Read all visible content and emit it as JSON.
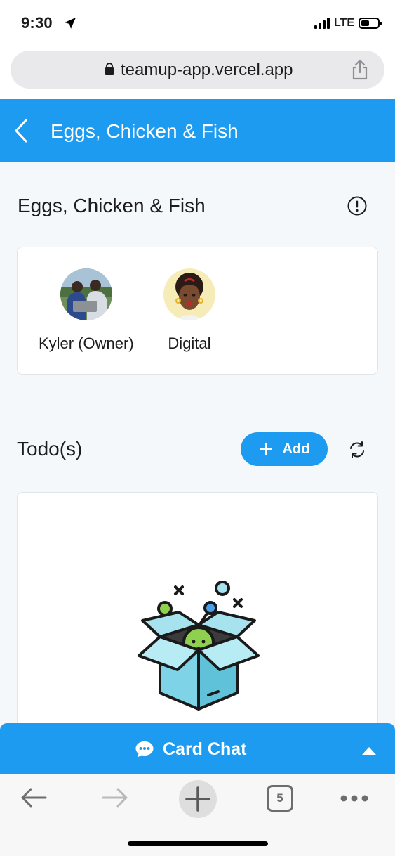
{
  "status_bar": {
    "time": "9:30",
    "network": "LTE",
    "icons": [
      "location-arrow-icon",
      "signal-icon",
      "battery-icon"
    ]
  },
  "browser": {
    "url": "teamup-app.vercel.app",
    "toolbar": {
      "tabs_count": "5",
      "icons": [
        "back-arrow-icon",
        "forward-arrow-icon",
        "new-tab-plus-icon",
        "tabs-icon",
        "more-icon"
      ]
    }
  },
  "header": {
    "title": "Eggs, Chicken & Fish",
    "back_icon": "chevron-left-icon"
  },
  "group": {
    "title": "Eggs, Chicken & Fish",
    "info_icon": "info-circle-icon"
  },
  "members": [
    {
      "name": "Kyler (Owner)"
    },
    {
      "name": "Digital"
    }
  ],
  "todos": {
    "title": "Todo(s)",
    "add_label": "Add",
    "refresh_icon": "refresh-icon",
    "empty_illustration": "empty-box-icon"
  },
  "chat": {
    "label": "Card Chat",
    "icon": "chat-bubble-icon",
    "toggle_icon": "triangle-up-icon"
  },
  "colors": {
    "accent": "#1d9bf0",
    "background": "#f5f8fb",
    "card_border": "#e1e5ea"
  }
}
